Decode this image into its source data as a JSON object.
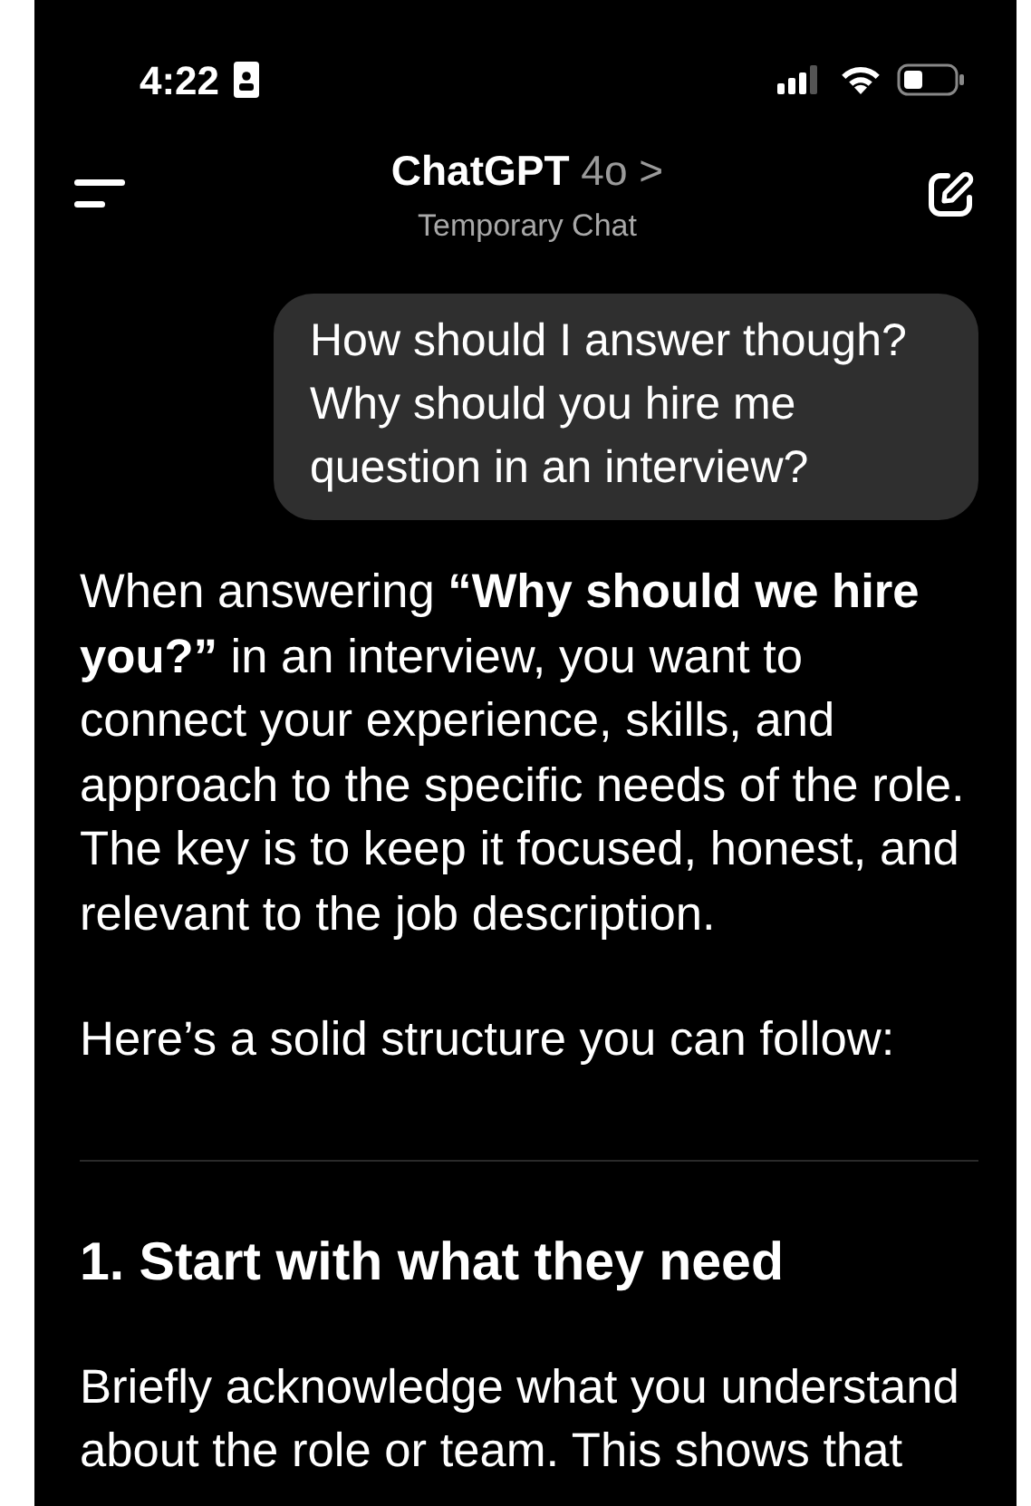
{
  "status_bar": {
    "time": "4:22"
  },
  "header": {
    "title": "ChatGPT",
    "model": "4o",
    "chevron": ">",
    "subtitle": "Temporary Chat"
  },
  "messages": [
    {
      "kind": "user",
      "text": "How should I answer though? Why should you hire me question in an interview?"
    },
    {
      "kind": "assistant",
      "blocks": [
        {
          "kind": "paragraph",
          "text": "When answering **“Why should we hire you?”** in an interview, you want to connect your experience, skills, and approach to the specific needs of the role. The key is to keep it focused, honest, and relevant to the job description."
        },
        {
          "kind": "paragraph",
          "text": "Here’s a solid structure you can follow:"
        },
        {
          "kind": "divider"
        },
        {
          "kind": "heading",
          "text": "1. Start with what they need"
        },
        {
          "kind": "paragraph",
          "text": "Briefly acknowledge what you understand about the role or team. This shows that"
        }
      ]
    }
  ]
}
